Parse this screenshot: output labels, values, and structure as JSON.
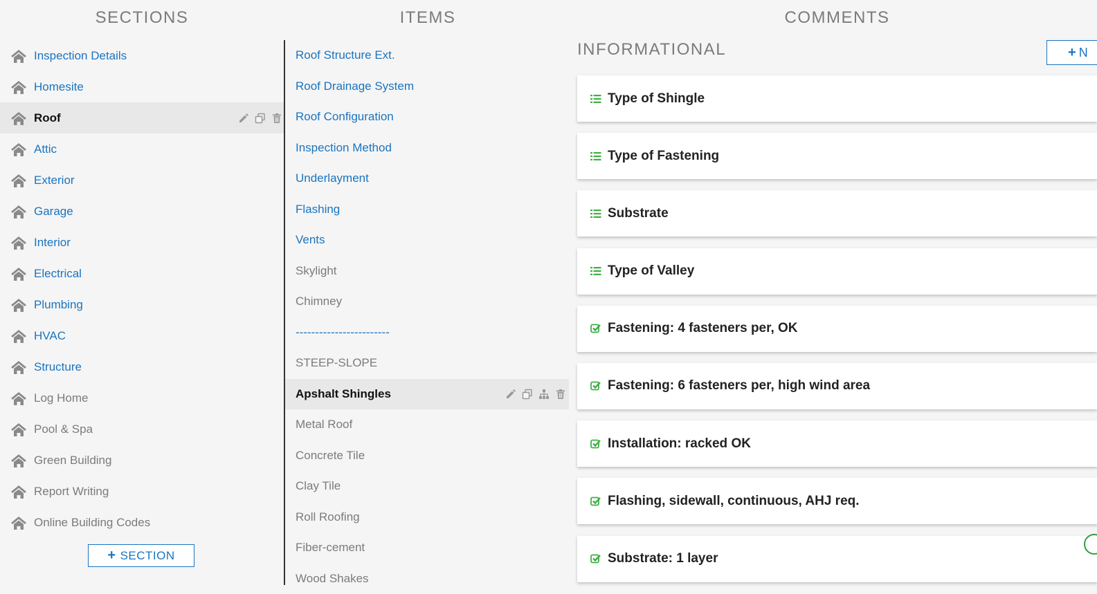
{
  "headers": {
    "sections": "SECTIONS",
    "items": "ITEMS",
    "comments": "COMMENTS"
  },
  "sections": [
    {
      "label": "Inspection Details",
      "state": "link"
    },
    {
      "label": "Homesite",
      "state": "link"
    },
    {
      "label": "Roof",
      "state": "active"
    },
    {
      "label": "Attic",
      "state": "link"
    },
    {
      "label": "Exterior",
      "state": "link"
    },
    {
      "label": "Garage",
      "state": "link"
    },
    {
      "label": "Interior",
      "state": "link"
    },
    {
      "label": "Electrical",
      "state": "link"
    },
    {
      "label": "Plumbing",
      "state": "link"
    },
    {
      "label": "HVAC",
      "state": "link"
    },
    {
      "label": "Structure",
      "state": "link"
    },
    {
      "label": "Log Home",
      "state": "muted"
    },
    {
      "label": "Pool & Spa",
      "state": "muted"
    },
    {
      "label": "Green Building",
      "state": "muted"
    },
    {
      "label": "Report Writing",
      "state": "muted"
    },
    {
      "label": "Online Building Codes",
      "state": "muted"
    }
  ],
  "add_section_label": "SECTION",
  "items": [
    {
      "label": "Roof Structure Ext.",
      "state": "link"
    },
    {
      "label": "Roof Drainage System",
      "state": "link"
    },
    {
      "label": "Roof Configuration",
      "state": "link"
    },
    {
      "label": "Inspection Method",
      "state": "link"
    },
    {
      "label": "Underlayment",
      "state": "link"
    },
    {
      "label": "Flashing",
      "state": "link"
    },
    {
      "label": "Vents",
      "state": "link"
    },
    {
      "label": "Skylight",
      "state": "muted"
    },
    {
      "label": "Chimney",
      "state": "muted"
    },
    {
      "label": "------------------------",
      "state": "link"
    },
    {
      "label": "STEEP-SLOPE",
      "state": "muted"
    },
    {
      "label": "Apshalt Shingles",
      "state": "active"
    },
    {
      "label": "Metal Roof",
      "state": "muted"
    },
    {
      "label": "Concrete Tile",
      "state": "muted"
    },
    {
      "label": "Clay Tile",
      "state": "muted"
    },
    {
      "label": "Roll Roofing",
      "state": "muted"
    },
    {
      "label": "Fiber-cement",
      "state": "muted"
    },
    {
      "label": "Wood Shakes",
      "state": "muted"
    }
  ],
  "comments": {
    "category": "INFORMATIONAL",
    "new_button_label": "N",
    "cards": [
      {
        "label": "Type of Shingle",
        "icon": "list-icon"
      },
      {
        "label": "Type of Fastening",
        "icon": "list-icon"
      },
      {
        "label": "Substrate",
        "icon": "list-icon"
      },
      {
        "label": "Type of Valley",
        "icon": "list-icon"
      },
      {
        "label": "Fastening: 4 fasteners per, OK",
        "icon": "checkbox-icon"
      },
      {
        "label": "Fastening: 6 fasteners per, high wind area",
        "icon": "checkbox-icon"
      },
      {
        "label": "Installation: racked OK",
        "icon": "checkbox-icon"
      },
      {
        "label": "Flashing, sidewall, continuous, AHJ req.",
        "icon": "checkbox-icon"
      },
      {
        "label": "Substrate: 1 layer",
        "icon": "checkbox-icon"
      }
    ]
  },
  "colors": {
    "link": "#1a74c0",
    "muted": "#7b7b7b",
    "accent_green": "#3cb043",
    "house_icon": "#8a8a8a"
  }
}
